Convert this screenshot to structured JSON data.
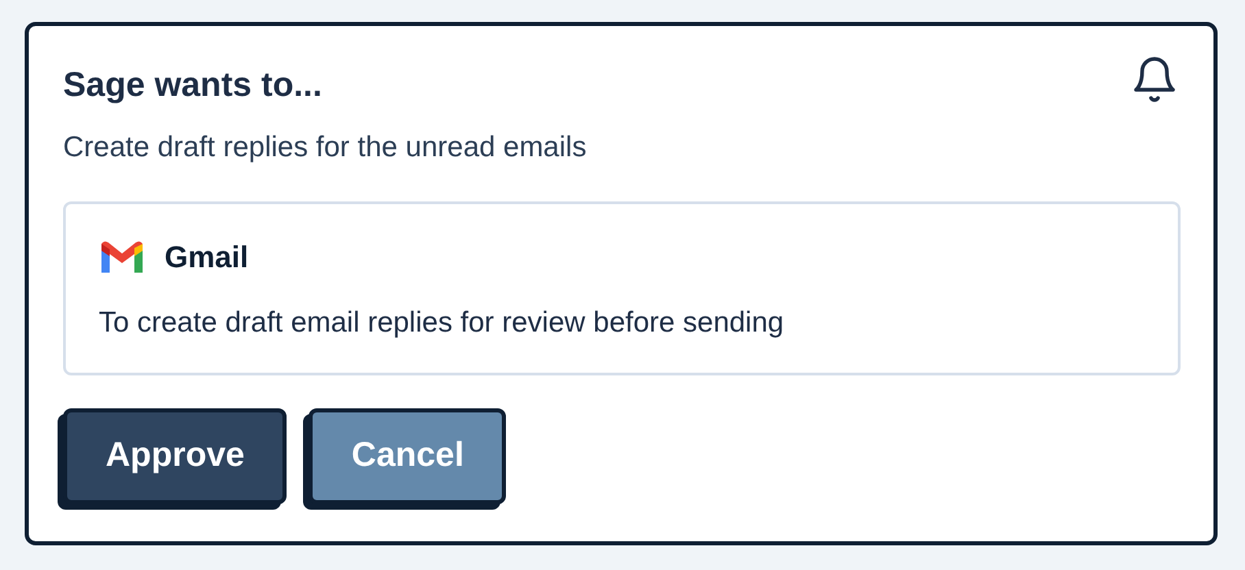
{
  "card": {
    "title": "Sage wants to...",
    "description": "Create draft replies for the unread emails"
  },
  "permission": {
    "service": "Gmail",
    "purpose": "To create draft email replies for review before sending"
  },
  "buttons": [
    {
      "label": "Approve",
      "kind": "primary"
    },
    {
      "label": "Cancel",
      "kind": "secondary"
    }
  ]
}
